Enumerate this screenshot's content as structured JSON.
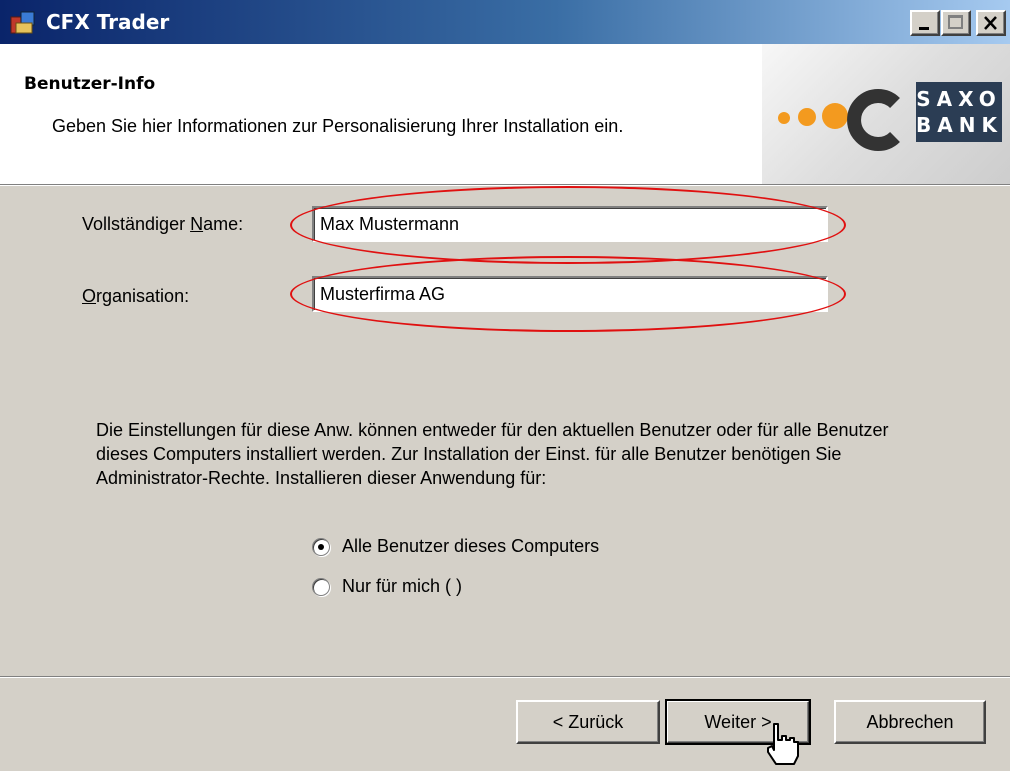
{
  "window": {
    "title": "CFX Trader"
  },
  "header": {
    "title": "Benutzer-Info",
    "subtitle": "Geben Sie hier Informationen zur Personalisierung Ihrer Installation ein."
  },
  "logo": {
    "line1": "SAXO",
    "line2": "BANK"
  },
  "form": {
    "name_label_pre": "Vollständiger ",
    "name_label_key": "N",
    "name_label_post": "ame:",
    "name_value": "Max Mustermann",
    "org_label_key": "O",
    "org_label_post": "rganisation:",
    "org_value": "Musterfirma AG"
  },
  "info_text": "Die Einstellungen für diese Anw. können entweder für den aktuellen Benutzer oder für alle Benutzer dieses Computers installiert werden. Zur Installation der Einst. für alle Benutzer benötigen Sie Administrator-Rechte. Installieren dieser Anwendung für:",
  "options": [
    {
      "label": "Alle Benutzer dieses Computers",
      "selected": true
    },
    {
      "label": "Nur für mich ( )",
      "selected": false
    }
  ],
  "buttons": {
    "back": "< Zurück",
    "next": "Weiter >",
    "cancel": "Abbrechen"
  },
  "colors": {
    "highlight_ellipse": "#e01010",
    "logo_orange": "#f39a1f",
    "logo_dark": "#2b3d54"
  }
}
